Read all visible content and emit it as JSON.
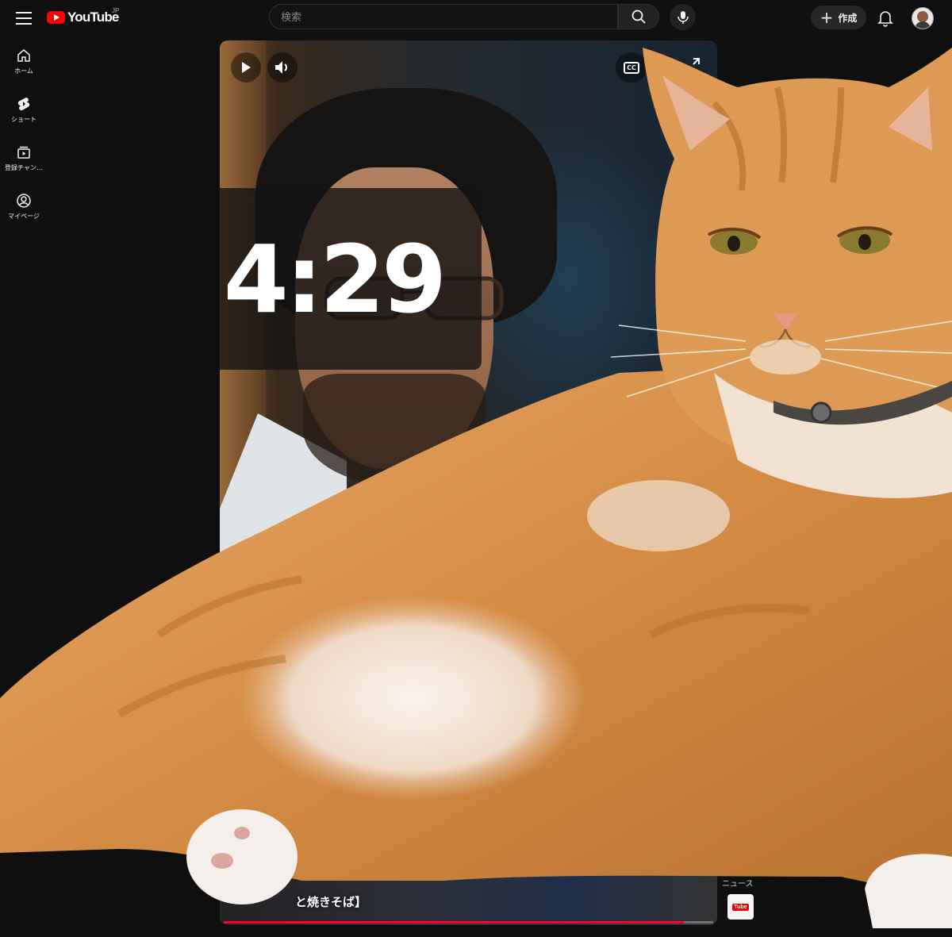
{
  "header": {
    "logo_text": "YouTube",
    "region": "JP",
    "search_placeholder": "検索",
    "create_label": "作成"
  },
  "sidebar": {
    "items": [
      {
        "label": "ホーム",
        "icon": "home-icon"
      },
      {
        "label": "ショート",
        "icon": "shorts-icon"
      },
      {
        "label": "登録チャン…",
        "icon": "subscriptions-icon"
      },
      {
        "label": "マイページ",
        "icon": "you-icon"
      }
    ]
  },
  "player": {
    "timer": "4:29",
    "caption": "と焼きそば】",
    "progress": 0.94,
    "channel_label": "ニュース"
  },
  "colors": {
    "accent": "#ff0000",
    "background": "#0f0f0f",
    "progress": "#ff0033",
    "cat_fur": "#d9964f"
  }
}
